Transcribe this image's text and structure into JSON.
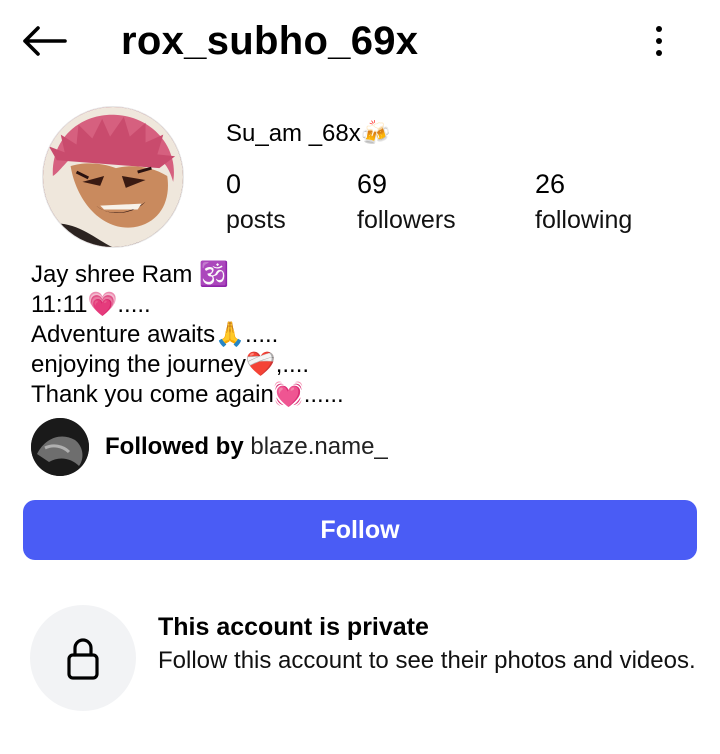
{
  "header": {
    "back_icon": "arrow-left-icon",
    "username": "rox_subho_69x",
    "more_icon": "more-vertical-icon"
  },
  "profile": {
    "avatar_icon": "profile-avatar",
    "display_name": "Su_am _68x🍻",
    "stats": {
      "posts": {
        "count": "0",
        "label": "posts"
      },
      "followers": {
        "count": "69",
        "label": "followers"
      },
      "following": {
        "count": "26",
        "label": "following"
      }
    },
    "bio": [
      "Jay shree Ram 🕉️",
      "11:11💗.....",
      "Adventure awaits🙏.....",
      "enjoying the journey❤️‍🩹,....",
      "Thank you come again💓......"
    ],
    "followed_by": {
      "prefix": "Followed by",
      "username": "blaze.name_"
    }
  },
  "actions": {
    "follow_label": "Follow"
  },
  "private_notice": {
    "icon": "lock-icon",
    "title": "This account is private",
    "description": "Follow this account to see their photos and videos."
  },
  "colors": {
    "accent": "#4a5cf5",
    "lock_bg": "#f2f3f5"
  }
}
